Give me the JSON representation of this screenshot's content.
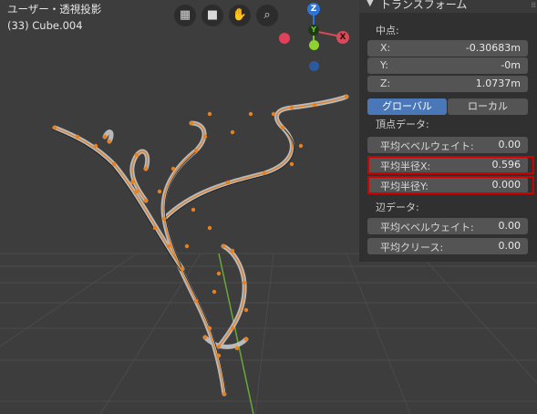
{
  "viewport": {
    "title": "ユーザー・透視投影",
    "object": "(33) Cube.004",
    "nav_icons": [
      "grid-view-icon",
      "camera-icon",
      "hand-pan-icon",
      "zoom-icon"
    ],
    "gizmo": {
      "z": "Z",
      "y": "Y",
      "x": "X"
    }
  },
  "panel": {
    "title": "トランスフォーム",
    "midpoint_label": "中点:",
    "x": {
      "label": "X:",
      "value": "-0.30683m"
    },
    "y": {
      "label": "Y:",
      "value": "-0m"
    },
    "z": {
      "label": "Z:",
      "value": "1.0737m"
    },
    "global": "グローバル",
    "local": "ローカル",
    "vertex_data_label": "頂点データ:",
    "vertex_bevel": {
      "label": "平均ベベルウェイト:",
      "value": "0.00"
    },
    "radius_x": {
      "label": "平均半径X:",
      "value": "0.596"
    },
    "radius_y": {
      "label": "平均半径Y:",
      "value": "0.000"
    },
    "edge_data_label": "辺データ:",
    "edge_bevel": {
      "label": "平均ベベルウェイト:",
      "value": "0.00"
    },
    "edge_crease": {
      "label": "平均クリース:",
      "value": "0.00"
    }
  },
  "colors": {
    "accent": "#4a77b8",
    "highlight": "#d40000",
    "vertex": "#e8801c"
  }
}
